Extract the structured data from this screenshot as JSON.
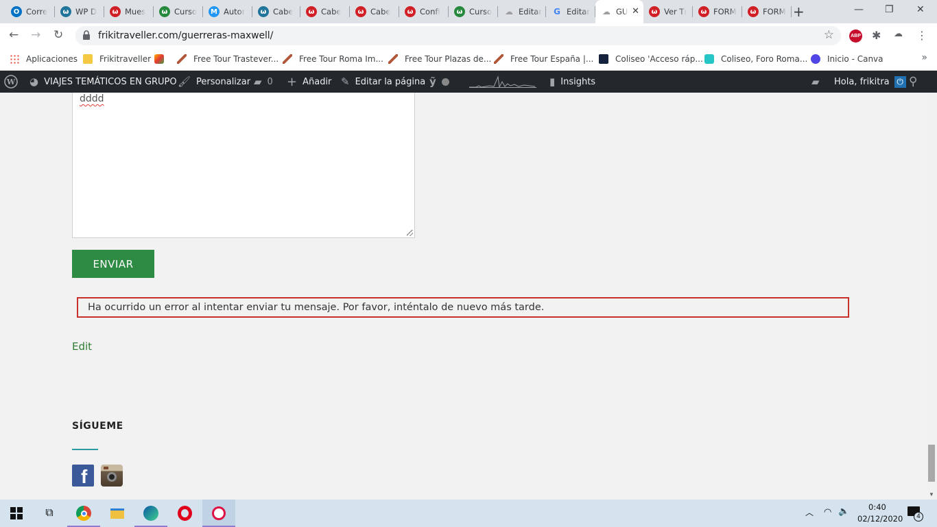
{
  "browser": {
    "tabs": [
      {
        "label": "Corre",
        "icon": "outlook-icon",
        "color": "#0072c6"
      },
      {
        "label": "WP D",
        "icon": "wordpress-icon",
        "color": "#21759b"
      },
      {
        "label": "Mues",
        "icon": "red-w-icon",
        "color": "#d11f26"
      },
      {
        "label": "Curso",
        "icon": "green-w-icon",
        "color": "#27893d"
      },
      {
        "label": "Autor",
        "icon": "m-logo-icon",
        "color": "#2196f3"
      },
      {
        "label": "Cabe",
        "icon": "wordpress-icon",
        "color": "#21759b"
      },
      {
        "label": "Cabe",
        "icon": "red-w-icon",
        "color": "#d11f26"
      },
      {
        "label": "Cabe",
        "icon": "red-w-icon",
        "color": "#d11f26"
      },
      {
        "label": "Confi",
        "icon": "red-w-icon",
        "color": "#d11f26"
      },
      {
        "label": "Curso",
        "icon": "green-w-icon",
        "color": "#27893d"
      },
      {
        "label": "Editar",
        "icon": "cloud-icon",
        "color": "#9e9e9e"
      },
      {
        "label": "Editar",
        "icon": "google-icon",
        "color": "#4285f4"
      },
      {
        "label": "GU",
        "icon": "cloud-icon",
        "color": "#9e9e9e",
        "active": true
      },
      {
        "label": "Ver Tı",
        "icon": "w-logo-icon",
        "color": "#d11f26"
      },
      {
        "label": "FORM",
        "icon": "red-w-icon",
        "color": "#d11f26"
      },
      {
        "label": "FORM",
        "icon": "red-w-icon",
        "color": "#d11f26"
      }
    ],
    "url": "frikitraveller.com/guerreras-maxwell/",
    "bookmarks": [
      {
        "label": "Aplicaciones",
        "icon": "apps-grid-icon"
      },
      {
        "label": "Frikitraveller",
        "icon": "folder-icon"
      },
      {
        "label": "",
        "icon": "colorful-icon"
      },
      {
        "label": "Free Tour Trastever...",
        "icon": "umbrella-icon"
      },
      {
        "label": "Free Tour Roma Im...",
        "icon": "umbrella-icon"
      },
      {
        "label": "Free Tour Plazas de...",
        "icon": "umbrella-icon"
      },
      {
        "label": "Free Tour España |...",
        "icon": "umbrella-icon"
      },
      {
        "label": "Coliseo 'Acceso ráp...",
        "icon": "ticket-icon"
      },
      {
        "label": "Coliseo, Foro Roma...",
        "icon": "t-logo-icon"
      },
      {
        "label": "Inicio - Canva",
        "icon": "canva-icon"
      }
    ]
  },
  "adminbar": {
    "site": "VIAJES TEMÁTICOS EN GRUPO",
    "customize": "Personalizar",
    "comments": "0",
    "add": "Añadir",
    "edit_page": "Editar la página",
    "insights": "Insights",
    "greeting": "Hola, frikitra"
  },
  "content": {
    "textarea_value": "dddd",
    "send_label": "ENVIAR",
    "error_message": "Ha ocurrido un error al intentar enviar tu mensaje. Por favor, inténtalo de nuevo más tarde.",
    "edit_link": "Edit",
    "follow_heading": "SÍGUEME",
    "facebook_letter": "f"
  },
  "taskbar": {
    "time": "0:40",
    "date": "02/12/2020",
    "notifications": "4"
  },
  "colors": {
    "send_button": "#2e8b43",
    "error_border": "#c9302c",
    "edit_link": "#2e7d32",
    "admin_bar": "#23282d"
  }
}
